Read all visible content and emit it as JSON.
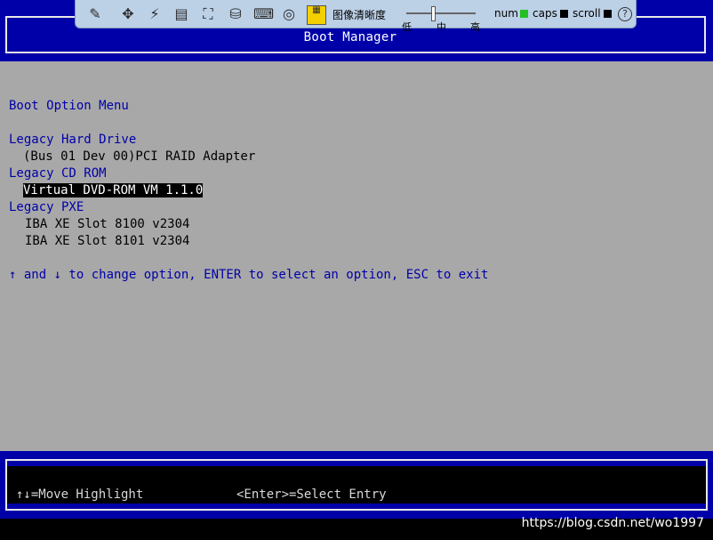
{
  "header": {
    "title": "Boot Manager"
  },
  "toolbar": {
    "icons": [
      "pointer-icon",
      "move-icon",
      "macro-icon",
      "video-icon",
      "fullscreen-icon",
      "media-icon",
      "usb-icon",
      "cd-icon",
      "calibrate-icon"
    ],
    "image_quality_label": "图像清晰度",
    "levels": {
      "low": "低",
      "mid": "中",
      "high": "高"
    },
    "indicators": {
      "num": {
        "label": "num",
        "color": "#22c022"
      },
      "caps": {
        "label": "caps",
        "color": "#000000"
      },
      "scroll": {
        "label": "scroll",
        "color": "#000000"
      }
    },
    "help_label": "?"
  },
  "menu": {
    "heading": "Boot Option Menu",
    "groups": [
      {
        "name": "Legacy Hard Drive",
        "items": [
          "(Bus 01 Dev 00)PCI RAID Adapter"
        ]
      },
      {
        "name": "Legacy CD ROM",
        "items": [
          "Virtual DVD-ROM VM 1.1.0"
        ]
      },
      {
        "name": "Legacy PXE",
        "items": [
          "IBA XE Slot 8100 v2304",
          "IBA XE Slot 8101 v2304"
        ]
      }
    ],
    "selected_item": "Virtual DVD-ROM VM 1.1.0",
    "instructions": "↑ and ↓ to change option, ENTER to select an option, ESC to exit"
  },
  "footer": {
    "hint_move": "↑↓=Move Highlight",
    "hint_enter": "<Enter>=Select Entry"
  },
  "watermark": "https://blog.csdn.net/wo1997",
  "colors": {
    "bios_blue": "#0000a8",
    "bios_grey": "#a8a8a8",
    "toolbar_bg": "#bcd0e6"
  }
}
